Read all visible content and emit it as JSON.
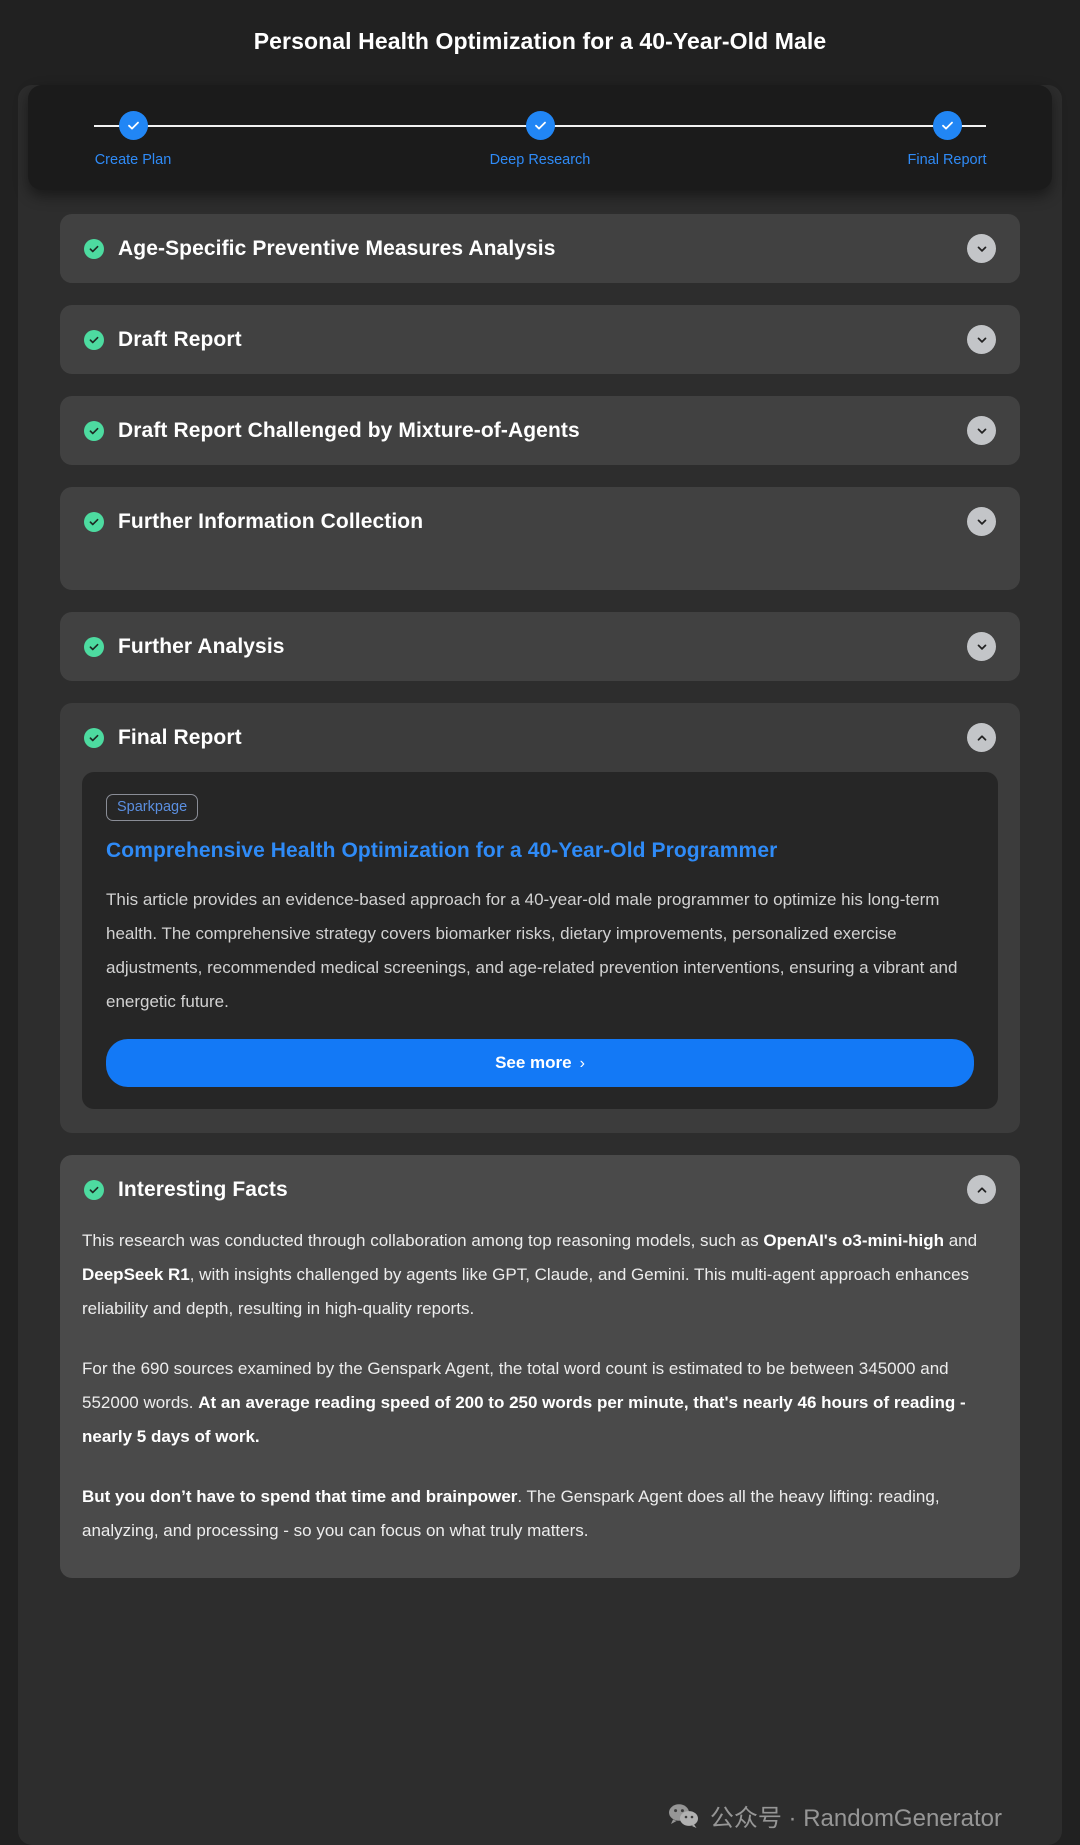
{
  "page": {
    "title": "Personal Health Optimization for a 40-Year-Old Male",
    "accent_blue": "#2f8bf7",
    "accent_green": "#4ddba0",
    "button_blue": "#1379f6",
    "page_bg": "#212121",
    "container_bg": "#2d2d2d",
    "card_bg": "#414141"
  },
  "stepper": {
    "steps": [
      {
        "label": "Create Plan",
        "state": "complete",
        "icon": "check-icon"
      },
      {
        "label": "Deep Research",
        "state": "complete",
        "icon": "check-icon"
      },
      {
        "label": "Final Report",
        "state": "complete",
        "icon": "check-icon"
      }
    ]
  },
  "sections": [
    {
      "title": "Age-Specific Preventive Measures Analysis",
      "status_icon": "check-circle-icon",
      "chevron": "chevron-down-icon",
      "expanded": false
    },
    {
      "title": "Draft Report",
      "status_icon": "check-circle-icon",
      "chevron": "chevron-down-icon",
      "expanded": false
    },
    {
      "title": "Draft Report Challenged by Mixture-of-Agents",
      "status_icon": "check-circle-icon",
      "chevron": "chevron-down-icon",
      "expanded": false
    },
    {
      "title": "Further Information Collection",
      "status_icon": "check-circle-icon",
      "chevron": "chevron-down-icon",
      "expanded": false
    },
    {
      "title": "Further Analysis",
      "status_icon": "check-circle-icon",
      "chevron": "chevron-down-icon",
      "expanded": false
    }
  ],
  "final_report": {
    "title": "Final Report",
    "status_icon": "check-circle-icon",
    "chevron": "chevron-up-icon",
    "expanded": true,
    "result": {
      "badge": "Sparkpage",
      "title": "Comprehensive Health Optimization for a 40-Year-Old Programmer",
      "description": "This article provides an evidence-based approach for a 40-year-old male programmer to optimize his long-term health. The comprehensive strategy covers biomarker risks, dietary improvements, personalized exercise adjustments, recommended medical screenings, and age-related prevention interventions, ensuring a vibrant and energetic future.",
      "see_more_label": "See more",
      "see_more_caret": "›"
    }
  },
  "interesting_facts": {
    "title": "Interesting Facts",
    "status_icon": "check-circle-icon",
    "chevron": "chevron-up-icon",
    "expanded": true,
    "paragraph1_pre": "This research was conducted through collaboration among top reasoning models, such as ",
    "paragraph1_b1": "OpenAI's o3-mini-high",
    "paragraph1_mid": " and ",
    "paragraph1_b2": "DeepSeek R1",
    "paragraph1_post": ", with insights challenged by agents like GPT, Claude, and Gemini. This multi-agent approach enhances reliability and depth, resulting in high-quality reports.",
    "paragraph2_pre": "For the 690 sources examined by the Genspark Agent, the total word count is estimated to be between 345000 and 552000 words. ",
    "paragraph2_b": "At an average reading speed of 200 to 250 words per minute, that's nearly 46 hours of reading - nearly 5 days of work.",
    "paragraph3_b": "But you don’t have to spend that time and brainpower",
    "paragraph3_post": ". The Genspark Agent does all the heavy lifting: reading, analyzing, and processing - so you can focus on what truly matters."
  },
  "watermark": {
    "icon": "wechat-icon",
    "text": "公众号 · RandomGenerator"
  }
}
